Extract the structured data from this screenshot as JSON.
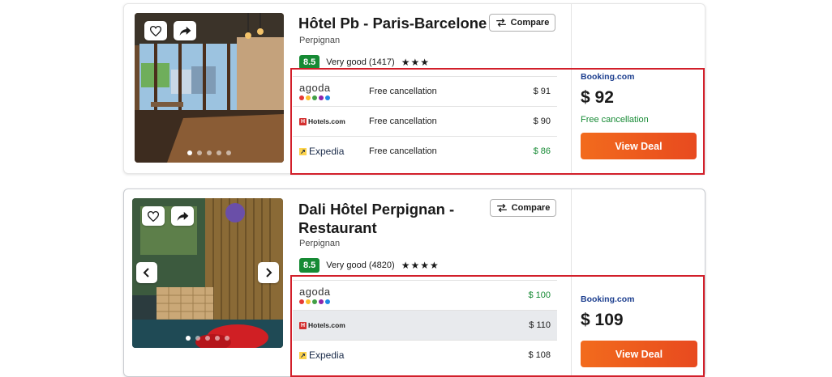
{
  "listings": [
    {
      "title": "Hôtel Pb - Paris-Barcelone",
      "city": "Perpignan",
      "score": "8.5",
      "rating_text": "Very good (1417)",
      "stars": "★★★",
      "compare_label": "Compare",
      "offers": [
        {
          "provider": "agoda",
          "provider_label": "agoda",
          "text": "Free cancellation",
          "price": "$ 91",
          "green": false
        },
        {
          "provider": "hotels",
          "provider_label": "Hotels.com",
          "text": "Free cancellation",
          "price": "$ 90",
          "green": false
        },
        {
          "provider": "expedia",
          "provider_label": "Expedia",
          "text": "Free cancellation",
          "price": "$ 86",
          "green": true
        }
      ],
      "deal": {
        "provider": "Booking.com",
        "price": "$ 92",
        "note": "Free cancellation",
        "button": "View Deal"
      }
    },
    {
      "title": "Dali Hôtel Perpignan - Restaurant",
      "city": "Perpignan",
      "score": "8.5",
      "rating_text": "Very good (4820)",
      "stars": "★★★★",
      "compare_label": "Compare",
      "offers": [
        {
          "provider": "agoda",
          "provider_label": "agoda",
          "text": "",
          "price": "$ 100",
          "green": true
        },
        {
          "provider": "hotels",
          "provider_label": "Hotels.com",
          "text": "",
          "price": "$ 110",
          "green": false
        },
        {
          "provider": "expedia",
          "provider_label": "Expedia",
          "text": "",
          "price": "$ 108",
          "green": false
        }
      ],
      "deal": {
        "provider": "Booking.com",
        "price": "$ 109",
        "note": "",
        "button": "View Deal"
      }
    }
  ],
  "colors": {
    "score_badge": "#168a34",
    "view_deal": "#e8561e",
    "highlight_box": "#d21f2a",
    "booking_brand": "#1d3f8f"
  },
  "icons": [
    "heart-icon",
    "share-icon",
    "compare-icon",
    "chevron-left-icon",
    "chevron-right-icon"
  ]
}
